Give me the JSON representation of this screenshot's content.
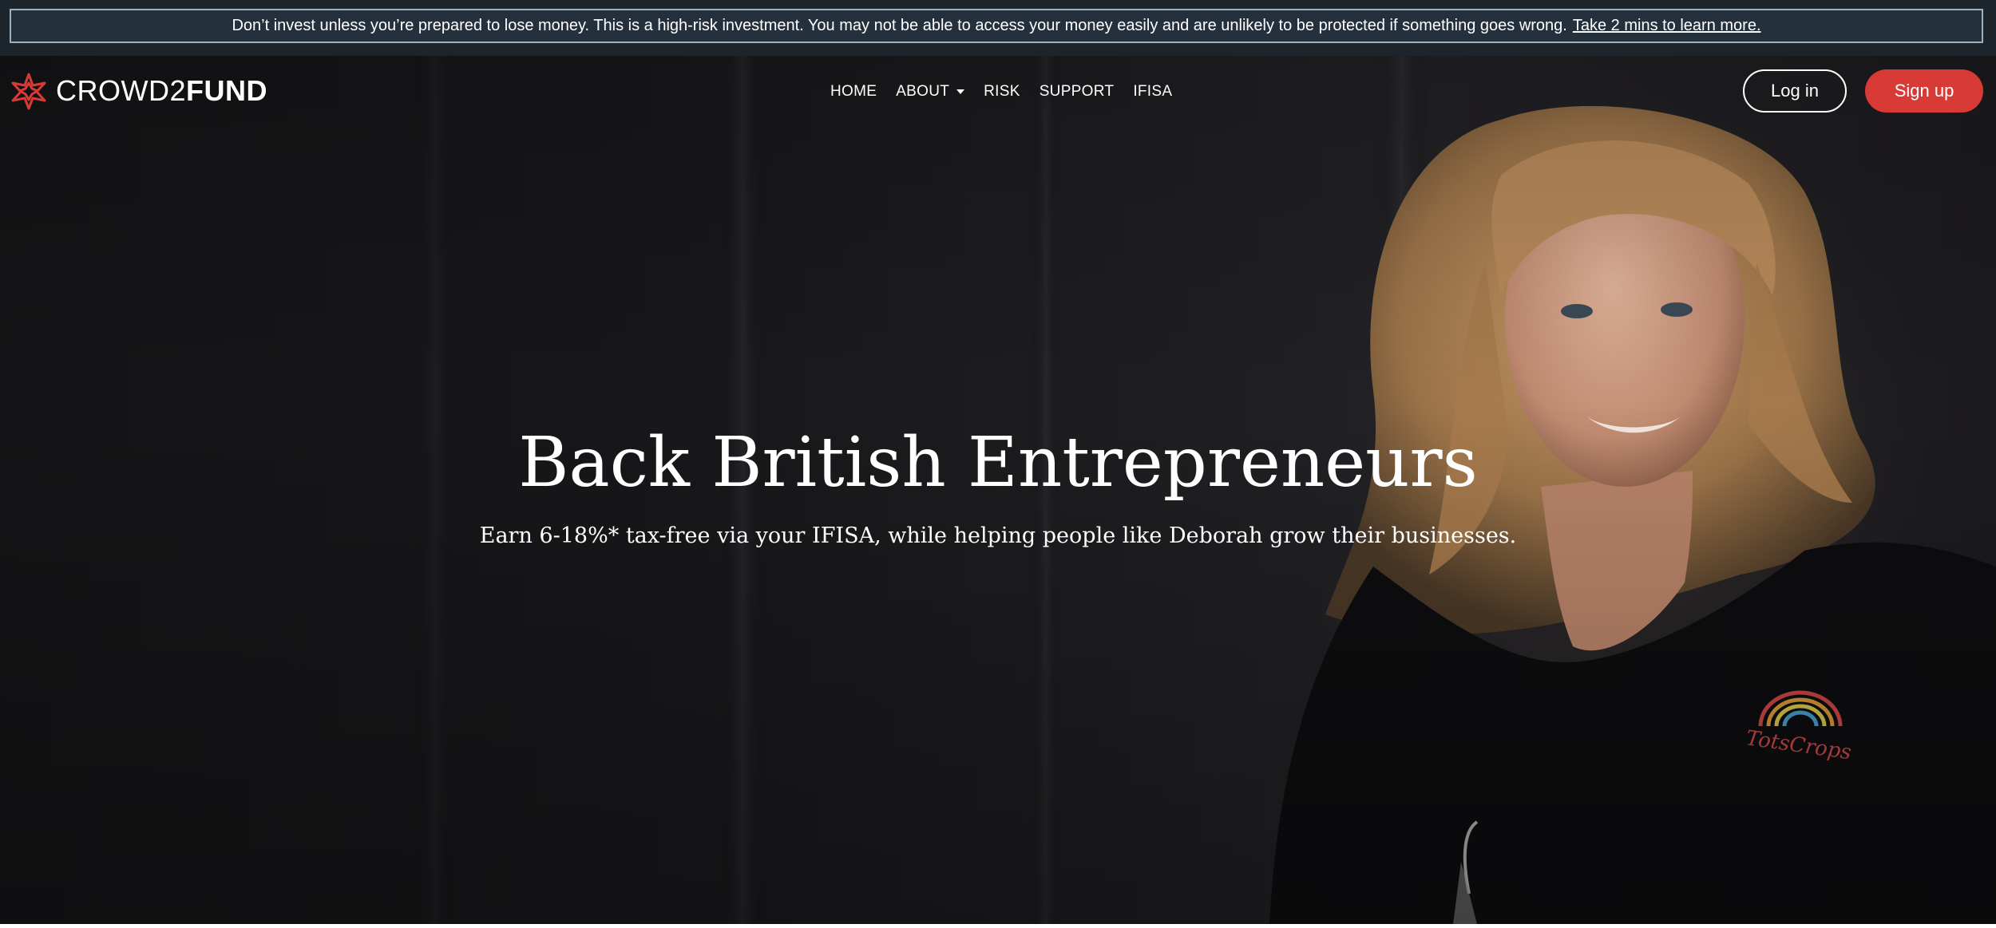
{
  "risk_banner": {
    "text": "Don’t invest unless you’re prepared to lose money. This is a high-risk investment. You may not be able to access your money easily and are unlikely to be protected if something goes wrong.",
    "link": "Take 2 mins to learn more."
  },
  "brand": {
    "name_light": "CROWD2",
    "name_bold": "FUND",
    "logo_icon": "star-flower-icon",
    "accent_color": "#d83a35"
  },
  "nav": {
    "items": [
      {
        "label": "HOME"
      },
      {
        "label": "ABOUT",
        "has_dropdown": true
      },
      {
        "label": "RISK"
      },
      {
        "label": "SUPPORT"
      },
      {
        "label": "IFISA"
      }
    ]
  },
  "auth": {
    "login_label": "Log in",
    "signup_label": "Sign up"
  },
  "hero": {
    "title": "Back British Entrepreneurs",
    "subtitle": "Earn 6-18%* tax-free via your IFISA, while helping people like Deborah grow their businesses.",
    "image_subject": "portrait of a smiling woman with shoulder-length blonde hair in a dark top"
  }
}
